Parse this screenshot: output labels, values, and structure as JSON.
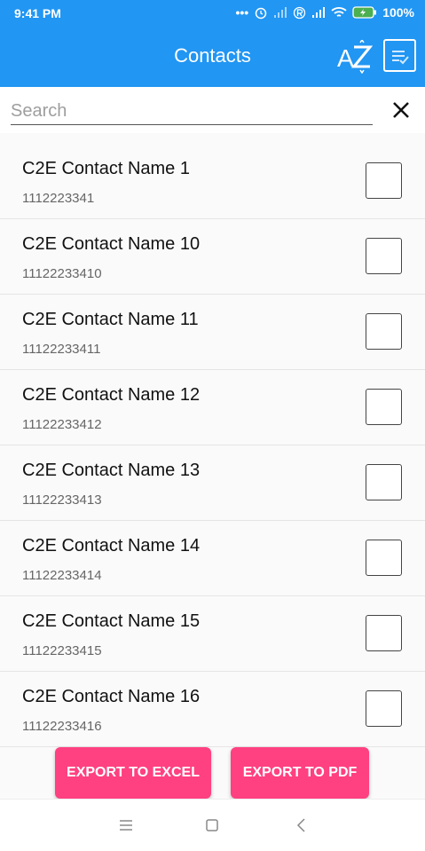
{
  "status": {
    "time": "9:41 PM",
    "battery": "100%"
  },
  "header": {
    "title": "Contacts",
    "sort_icon": "sort-az-icon",
    "select_icon": "select-all-icon"
  },
  "search": {
    "placeholder": "Search"
  },
  "contacts": [
    {
      "name": "C2E Contact Name 1",
      "phone": "1112223341"
    },
    {
      "name": "C2E Contact Name 10",
      "phone": "11122233410"
    },
    {
      "name": "C2E Contact Name 11",
      "phone": "11122233411"
    },
    {
      "name": "C2E Contact Name 12",
      "phone": "11122233412"
    },
    {
      "name": "C2E Contact Name 13",
      "phone": "11122233413"
    },
    {
      "name": "C2E Contact Name 14",
      "phone": "11122233414"
    },
    {
      "name": "C2E Contact Name 15",
      "phone": "11122233415"
    },
    {
      "name": "C2E Contact Name 16",
      "phone": "11122233416"
    }
  ],
  "actions": {
    "export_excel": "EXPORT TO EXCEL",
    "export_pdf": "EXPORT TO PDF"
  },
  "colors": {
    "primary": "#2196F3",
    "accent": "#FF4081"
  }
}
